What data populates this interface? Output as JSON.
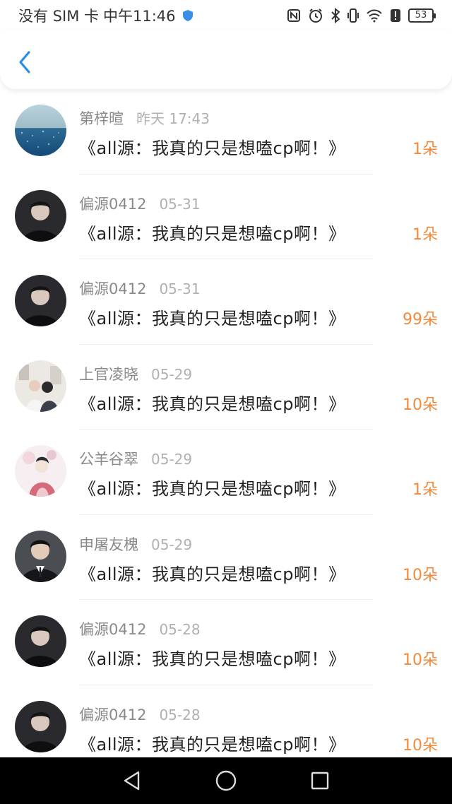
{
  "status_bar": {
    "carrier": "没有 SIM 卡",
    "time": "中午11:46",
    "battery": "53"
  },
  "header": {
    "back_icon": "chevron-left-icon",
    "accent": "#2b8ee6"
  },
  "colors": {
    "gift_count": "#f08a3c",
    "name": "#8a8a8a",
    "date": "#b0b0b0"
  },
  "list": [
    {
      "name": "第梓暄",
      "date": "昨天 17:43",
      "title": "《all源：我真的只是想嗑cp啊！》",
      "gift": "1朵",
      "avatar": "ocean"
    },
    {
      "name": "偏源0412",
      "date": "05-31",
      "title": "《all源：我真的只是想嗑cp啊！》",
      "gift": "1朵",
      "avatar": "dark-portrait"
    },
    {
      "name": "偏源0412",
      "date": "05-31",
      "title": "《all源：我真的只是想嗑cp啊！》",
      "gift": "99朵",
      "avatar": "dark-portrait"
    },
    {
      "name": "上官凌晓",
      "date": "05-29",
      "title": "《all源：我真的只是想嗑cp啊！》",
      "gift": "10朵",
      "avatar": "room"
    },
    {
      "name": "公羊谷翠",
      "date": "05-29",
      "title": "《all源：我真的只是想嗑cp啊！》",
      "gift": "1朵",
      "avatar": "illustration"
    },
    {
      "name": "申屠友槐",
      "date": "05-29",
      "title": "《all源：我真的只是想嗑cp啊！》",
      "gift": "10朵",
      "avatar": "suit-portrait"
    },
    {
      "name": "偏源0412",
      "date": "05-28",
      "title": "《all源：我真的只是想嗑cp啊！》",
      "gift": "10朵",
      "avatar": "dark-portrait"
    },
    {
      "name": "偏源0412",
      "date": "05-28",
      "title": "《all源：我真的只是想嗑cp啊！》",
      "gift": "10朵",
      "avatar": "dark-portrait"
    }
  ],
  "nav": {
    "back": "back-triangle-icon",
    "home": "home-circle-icon",
    "recents": "recents-square-icon"
  }
}
